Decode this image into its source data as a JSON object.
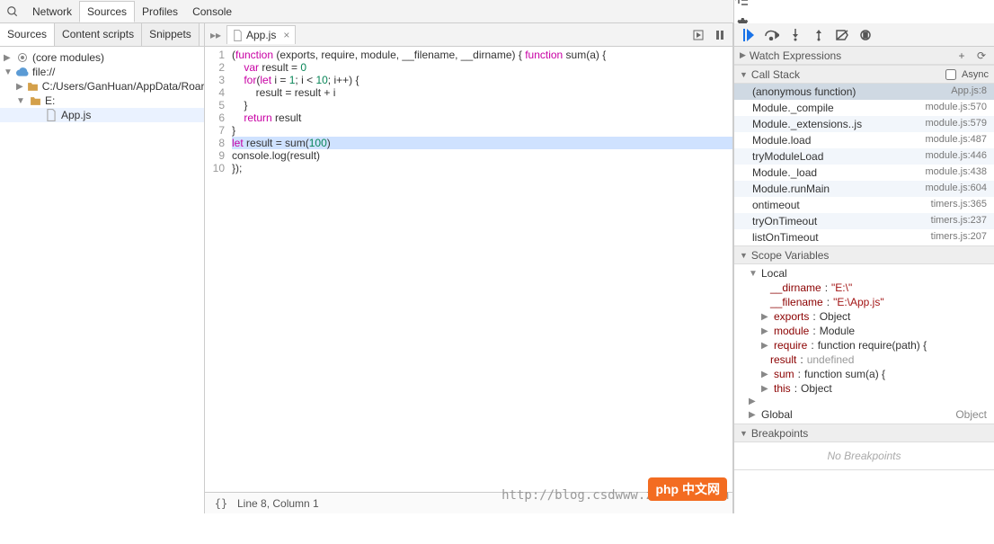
{
  "topTabs": {
    "network": "Network",
    "sources": "Sources",
    "profiles": "Profiles",
    "console": "Console"
  },
  "leftTabs": {
    "sources": "Sources",
    "content": "Content scripts",
    "snippets": "Snippets"
  },
  "tree": {
    "core": "(core modules)",
    "file": "file://",
    "folder1": "C:/Users/GanHuan/AppData/Roar",
    "folder2": "E:",
    "app": "App.js"
  },
  "fileTab": {
    "name": "App.js"
  },
  "code": {
    "lines": [
      "(function (exports, require, module, __filename, __dirname) { function sum(a) {",
      "    var result = 0",
      "    for(let i = 1; i < 10; i++) {",
      "        result = result + i",
      "    }",
      "    return result",
      "}",
      "let result = sum(100)",
      "console.log(result)",
      "});"
    ],
    "highlightLine": 8
  },
  "status": {
    "pos": "Line 8, Column 1"
  },
  "sections": {
    "watch": "Watch Expressions",
    "callstack": "Call Stack",
    "async": "Async",
    "scope": "Scope Variables",
    "local": "Local",
    "global": "Global",
    "globalVal": "Object",
    "bp": "Breakpoints",
    "nobp": "No Breakpoints"
  },
  "stack": [
    {
      "fn": "(anonymous function)",
      "loc": "App.js:8"
    },
    {
      "fn": "Module._compile",
      "loc": "module.js:570"
    },
    {
      "fn": "Module._extensions..js",
      "loc": "module.js:579"
    },
    {
      "fn": "Module.load",
      "loc": "module.js:487"
    },
    {
      "fn": "tryModuleLoad",
      "loc": "module.js:446"
    },
    {
      "fn": "Module._load",
      "loc": "module.js:438"
    },
    {
      "fn": "Module.runMain",
      "loc": "module.js:604"
    },
    {
      "fn": "ontimeout",
      "loc": "timers.js:365"
    },
    {
      "fn": "tryOnTimeout",
      "loc": "timers.js:237"
    },
    {
      "fn": "listOnTimeout",
      "loc": "timers.js:207"
    }
  ],
  "scopeVars": {
    "dirname": {
      "k": "__dirname",
      "v": "\"E:\\\""
    },
    "filename": {
      "k": "__filename",
      "v": "\"E:\\App.js\""
    },
    "exports": {
      "k": "exports",
      "v": "Object"
    },
    "module": {
      "k": "module",
      "v": "Module"
    },
    "require": {
      "k": "require",
      "v": "function require(path) {"
    },
    "result": {
      "k": "result",
      "v": "undefined"
    },
    "sum": {
      "k": "sum",
      "v": "function sum(a) {"
    },
    "this": {
      "k": "this",
      "v": "Object"
    }
  },
  "watermark": "http://blog.csdwww.zzsucai.com",
  "brand": "php 中文网"
}
